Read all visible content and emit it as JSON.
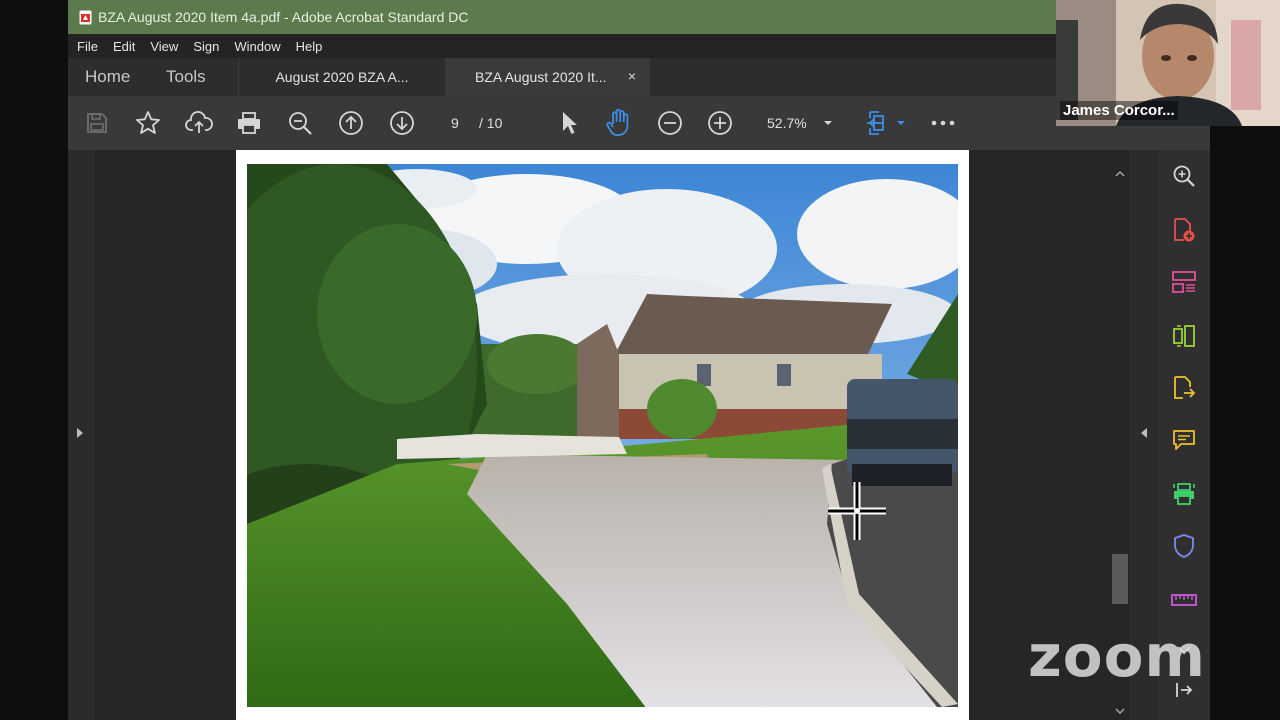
{
  "window": {
    "title": "BZA August 2020 Item 4a.pdf - Adobe Acrobat Standard DC"
  },
  "menu": [
    "File",
    "Edit",
    "View",
    "Sign",
    "Window",
    "Help"
  ],
  "nav": {
    "home": "Home",
    "tools": "Tools"
  },
  "tabs": [
    {
      "label": "August 2020 BZA A..."
    },
    {
      "label": "BZA August 2020 It...",
      "close": "×"
    }
  ],
  "toolbar": {
    "page_current": "9",
    "page_total": "/  10",
    "zoom": "52.7%"
  },
  "participant": {
    "name": "James Corcor..."
  },
  "watermark": {
    "text": "zoom"
  },
  "colors": {
    "title_bar": "#5c7a4b",
    "hand_tool": "#3b8ee8"
  }
}
